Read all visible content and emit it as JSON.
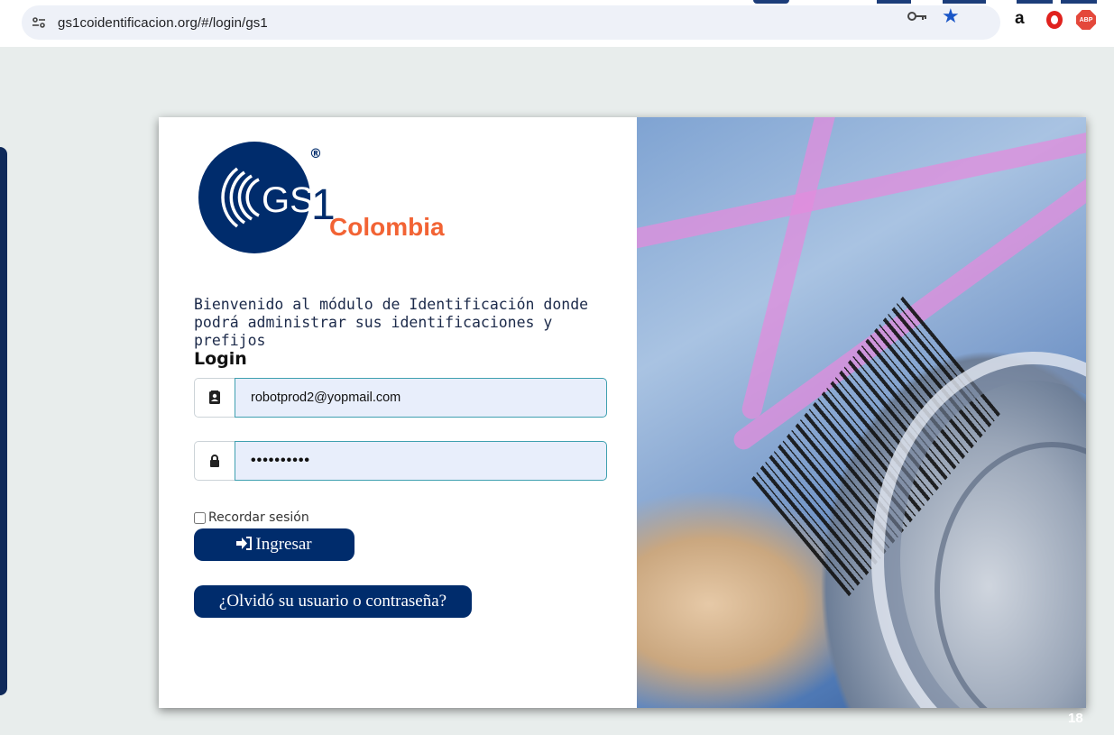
{
  "browser": {
    "url": "gs1coidentificacion.org/#/login/gs1",
    "icons": [
      "site-settings-icon",
      "password-key-icon",
      "bookmark-star-icon",
      "amazon-extension-icon",
      "opera-extension-icon",
      "adblock-plus-extension-icon"
    ],
    "abp_label": "ABP",
    "amazon_label": "a"
  },
  "logo": {
    "mark": "GS1",
    "registered": "®",
    "country": "Colombia"
  },
  "login": {
    "welcome": "Bienvenido al módulo de Identificación donde podrá administrar sus identificaciones y prefijos",
    "title": "Login",
    "email_value": "robotprod2@yopmail.com",
    "password_value": "••••••••••",
    "remember_label": "Recordar sesión",
    "login_button": "Ingresar",
    "forgot_button": "¿Olvidó su usuario o contraseña?"
  },
  "slide_number": "18",
  "colors": {
    "brand_navy": "#002c6c",
    "brand_orange": "#f26334",
    "input_bg": "#e8eefb",
    "input_border": "#3fa0b0"
  }
}
